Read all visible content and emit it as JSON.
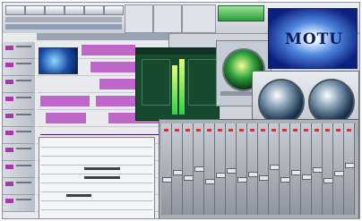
{
  "splash": {
    "logo_text": "MOTU"
  },
  "toolbar": {
    "buttons": [
      "",
      "",
      "",
      "",
      "",
      ""
    ]
  },
  "colors": {
    "track_clip": "#b84fc4",
    "plugin_bg": "#154a2c",
    "splash_blue": "#0b1f7c",
    "window_chrome": "#cfd4dc"
  },
  "icons": [
    "knob-icon",
    "vu-meter-icon",
    "fader-icon"
  ]
}
